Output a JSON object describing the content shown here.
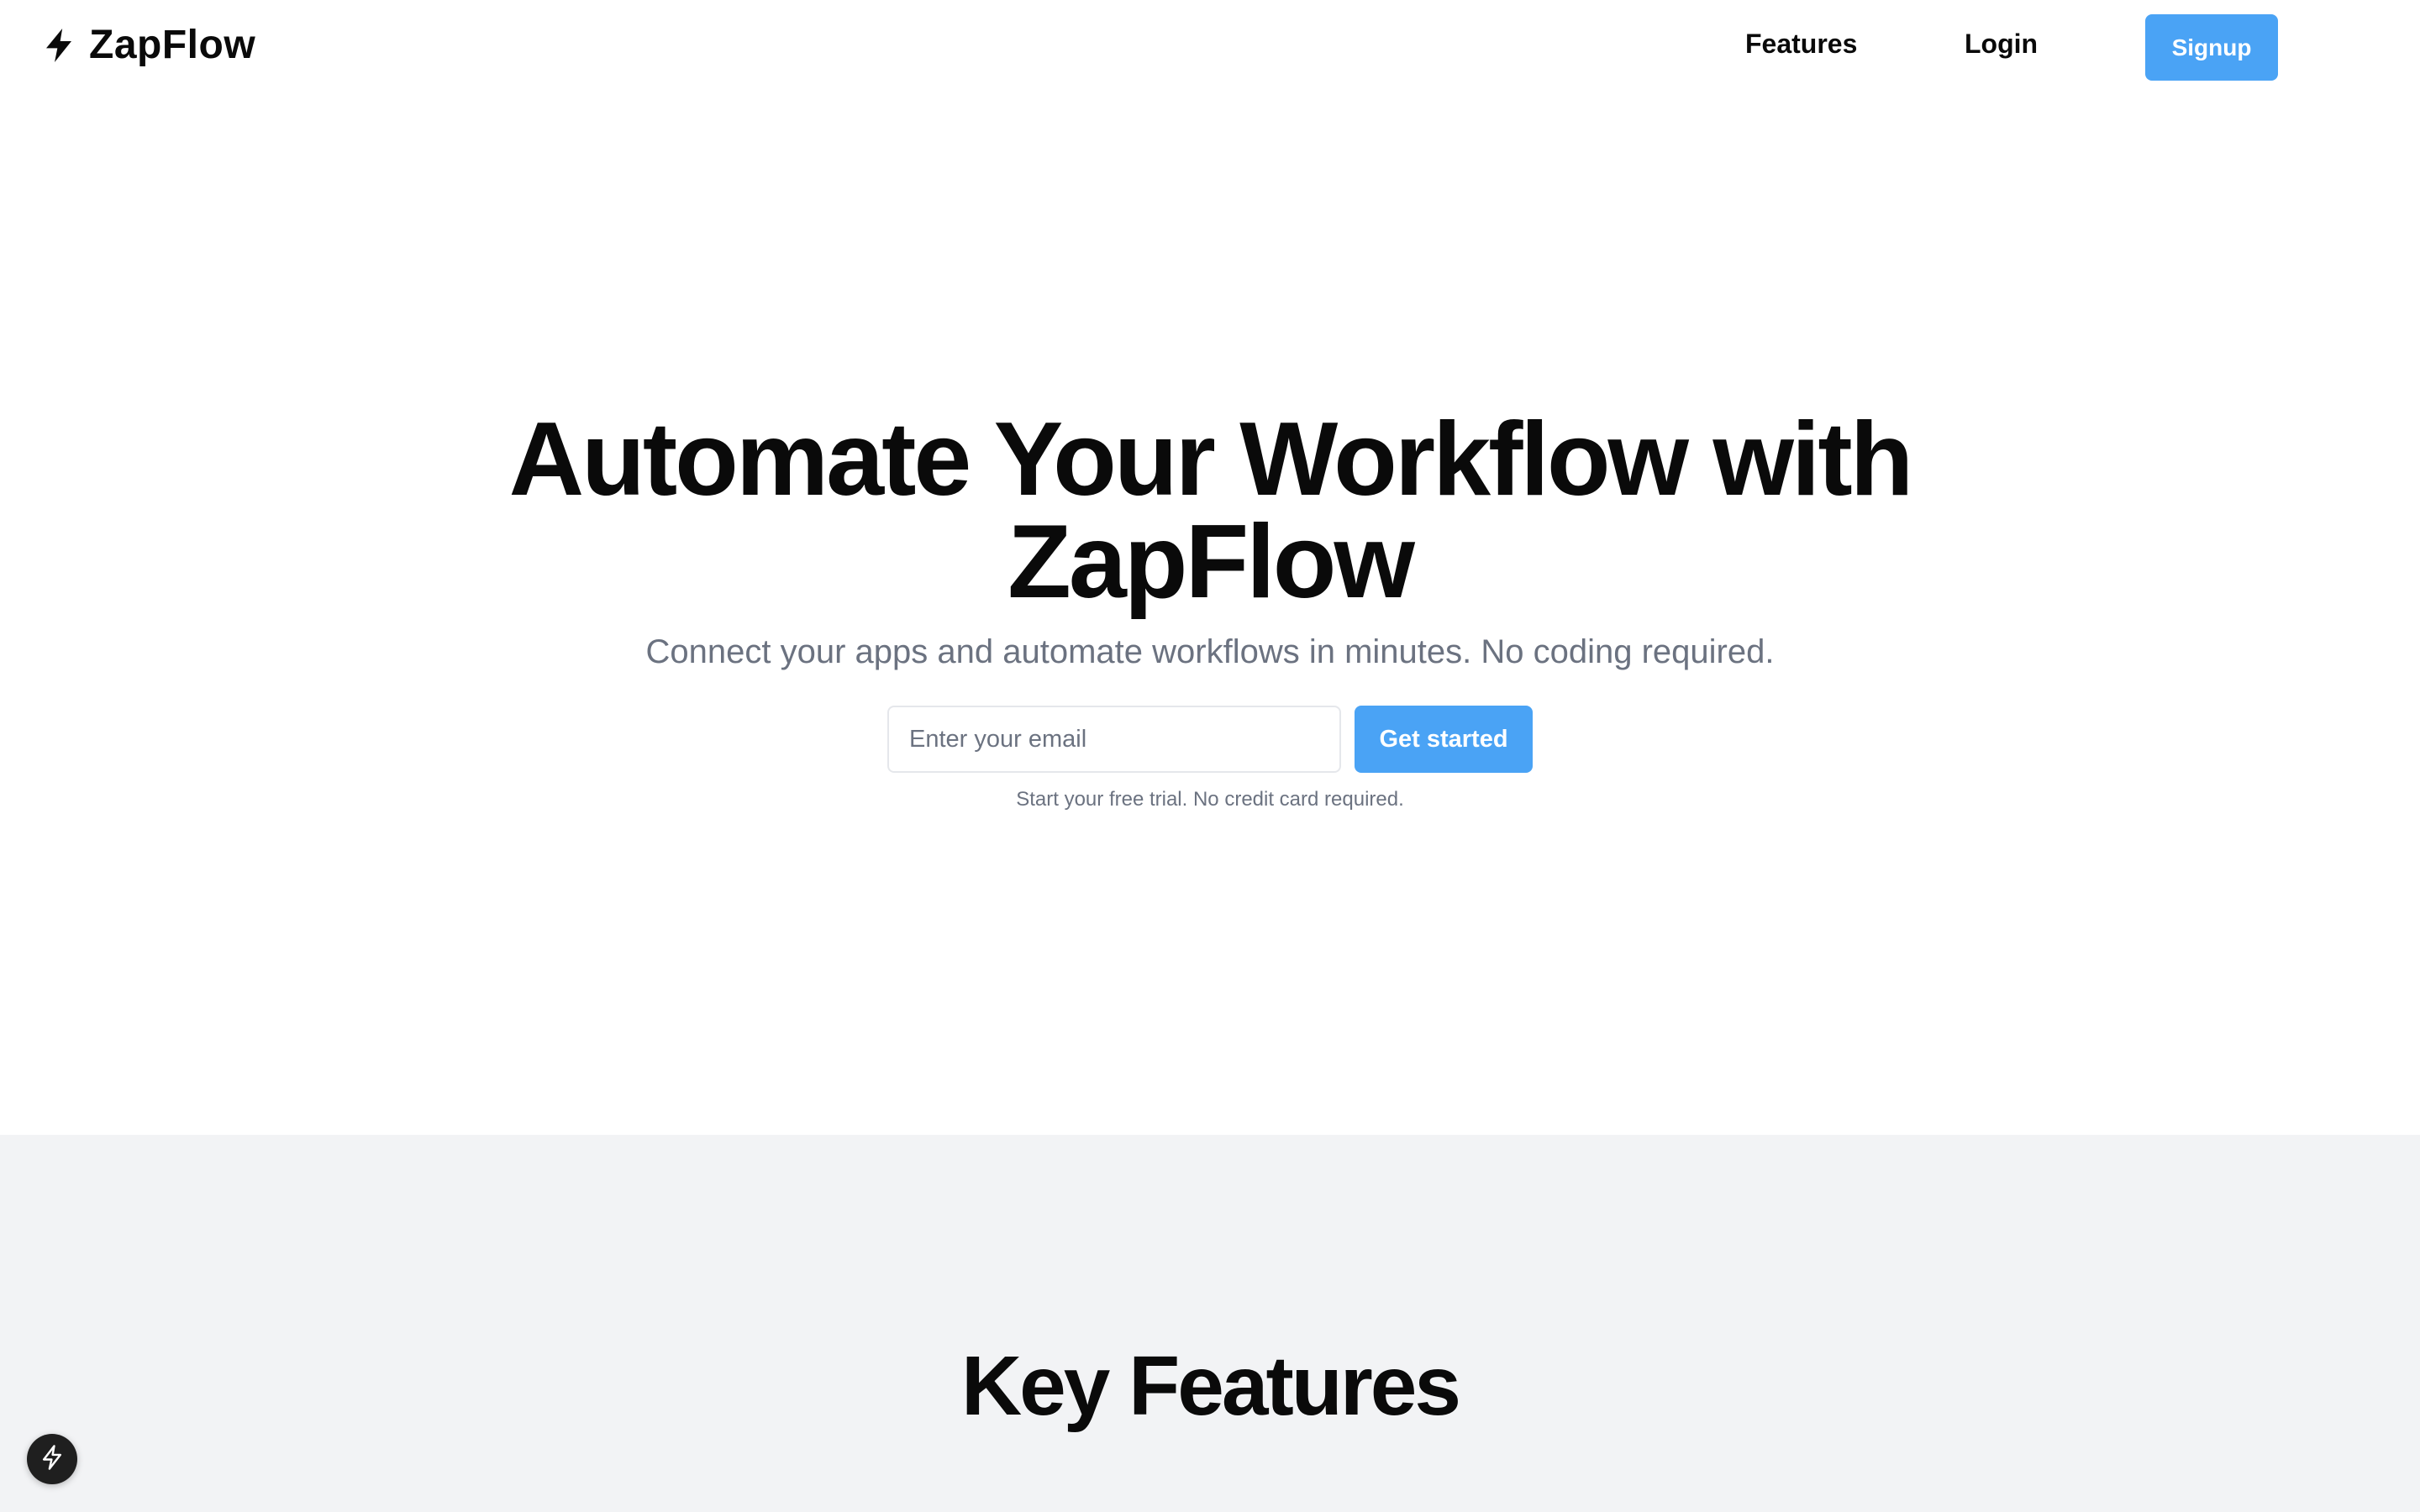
{
  "header": {
    "brand_name": "ZapFlow",
    "brand_icon": "bolt-icon",
    "nav": {
      "features": "Features",
      "login": "Login"
    },
    "signup_label": "Signup"
  },
  "hero": {
    "title_line1": "Automate Your Workflow with",
    "title_line2": "ZapFlow",
    "subtitle": "Connect your apps and automate workflows in minutes. No coding required.",
    "email_placeholder": "Enter your email",
    "email_value": "",
    "cta_label": "Get started",
    "note": "Start your free trial. No credit card required."
  },
  "features_section": {
    "title": "Key Features"
  },
  "floating_badge": {
    "icon": "bolt-outline-icon"
  },
  "colors": {
    "accent": "#4aa3f5",
    "text": "#0a0a0a",
    "muted": "#6b7280",
    "section_bg": "#f2f3f5"
  }
}
